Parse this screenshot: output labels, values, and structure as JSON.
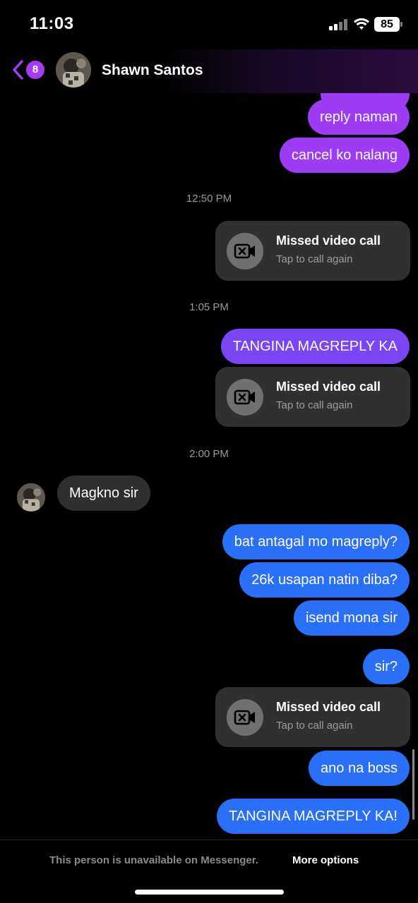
{
  "status_bar": {
    "time": "11:03",
    "battery": "85"
  },
  "header": {
    "unread_count": "8",
    "contact_name": "Shawn Santos"
  },
  "messages": {
    "m1": "reply naman",
    "m2": "cancel ko nalang",
    "ts1": "12:50 PM",
    "call1": {
      "title": "Missed video call",
      "sub": "Tap to call again"
    },
    "ts2": "1:05 PM",
    "m3": "TANGINA MAGREPLY KA",
    "call2": {
      "title": "Missed video call",
      "sub": "Tap to call again"
    },
    "ts3": "2:00 PM",
    "in1": "Magkno sir",
    "m4": "bat antagal mo magreply?",
    "m5": "26k usapan natin diba?",
    "m6": "isend mona sir",
    "m7": "sir?",
    "call3": {
      "title": "Missed video call",
      "sub": "Tap to call again"
    },
    "m8": "ano na boss",
    "m9": "TANGINA MAGREPLY KA!"
  },
  "footer": {
    "unavailable": "This person is unavailable on Messenger.",
    "more_options": "More options"
  },
  "colors": {
    "purple_bubble": "#9d3cf4",
    "violet_bubble": "#7a45f5",
    "blue_bubble": "#2a6ff7",
    "incoming_bubble": "#2f2f2f",
    "accent": "#a33cf2"
  },
  "icons": [
    "back-chevron-icon",
    "video-call-missed-icon",
    "signal-icon",
    "wifi-icon",
    "battery-icon"
  ]
}
